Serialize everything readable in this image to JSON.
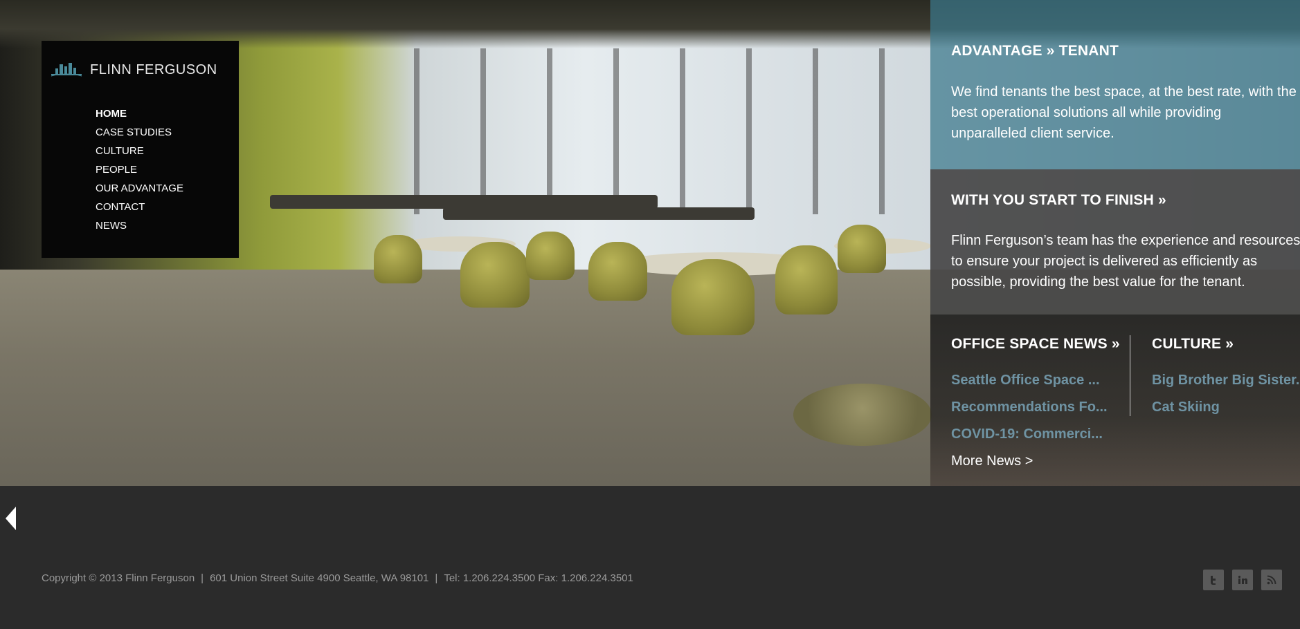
{
  "brand": {
    "name": "FLINN FERGUSON"
  },
  "nav": {
    "items": [
      {
        "label": "HOME",
        "active": true
      },
      {
        "label": "CASE STUDIES",
        "active": false
      },
      {
        "label": "CULTURE",
        "active": false
      },
      {
        "label": "PEOPLE",
        "active": false
      },
      {
        "label": "OUR ADVANTAGE",
        "active": false
      },
      {
        "label": "CONTACT",
        "active": false
      },
      {
        "label": "NEWS",
        "active": false
      }
    ]
  },
  "panel": {
    "advantage": {
      "heading": "ADVANTAGE » TENANT",
      "lines": [
        "We find tenants the best space, at the best rate, with the",
        "best operational solutions all while providing",
        "unparalleled client service."
      ]
    },
    "start_finish": {
      "heading": "WITH YOU START TO FINISH »",
      "lines": [
        "Flinn Ferguson’s team has the experience and resources",
        "to ensure your project is delivered as efficiently as",
        "possible, providing the best value for the tenant."
      ]
    },
    "news": {
      "heading": "OFFICE SPACE NEWS »",
      "links": [
        "Seattle Office Space ...",
        "Recommendations Fo...",
        "COVID-19: Commerci..."
      ],
      "more": "More News >"
    },
    "culture": {
      "heading": "CULTURE »",
      "links": [
        "Big Brother Big Sister...",
        "Cat Skiing"
      ]
    }
  },
  "footer": {
    "copyright": "Copyright © 2013 Flinn Ferguson",
    "address": "601 Union Street Suite 4900 Seattle, WA 98101",
    "phone": "Tel: 1.206.224.3500 Fax: 1.206.224.3501",
    "separator": "|",
    "social": [
      "twitter-icon",
      "linkedin-icon",
      "rss-icon"
    ]
  },
  "colors": {
    "accent_link": "#6f93a3",
    "panel_teal": "#3c788c",
    "footer_bg": "#2b2b2b"
  }
}
